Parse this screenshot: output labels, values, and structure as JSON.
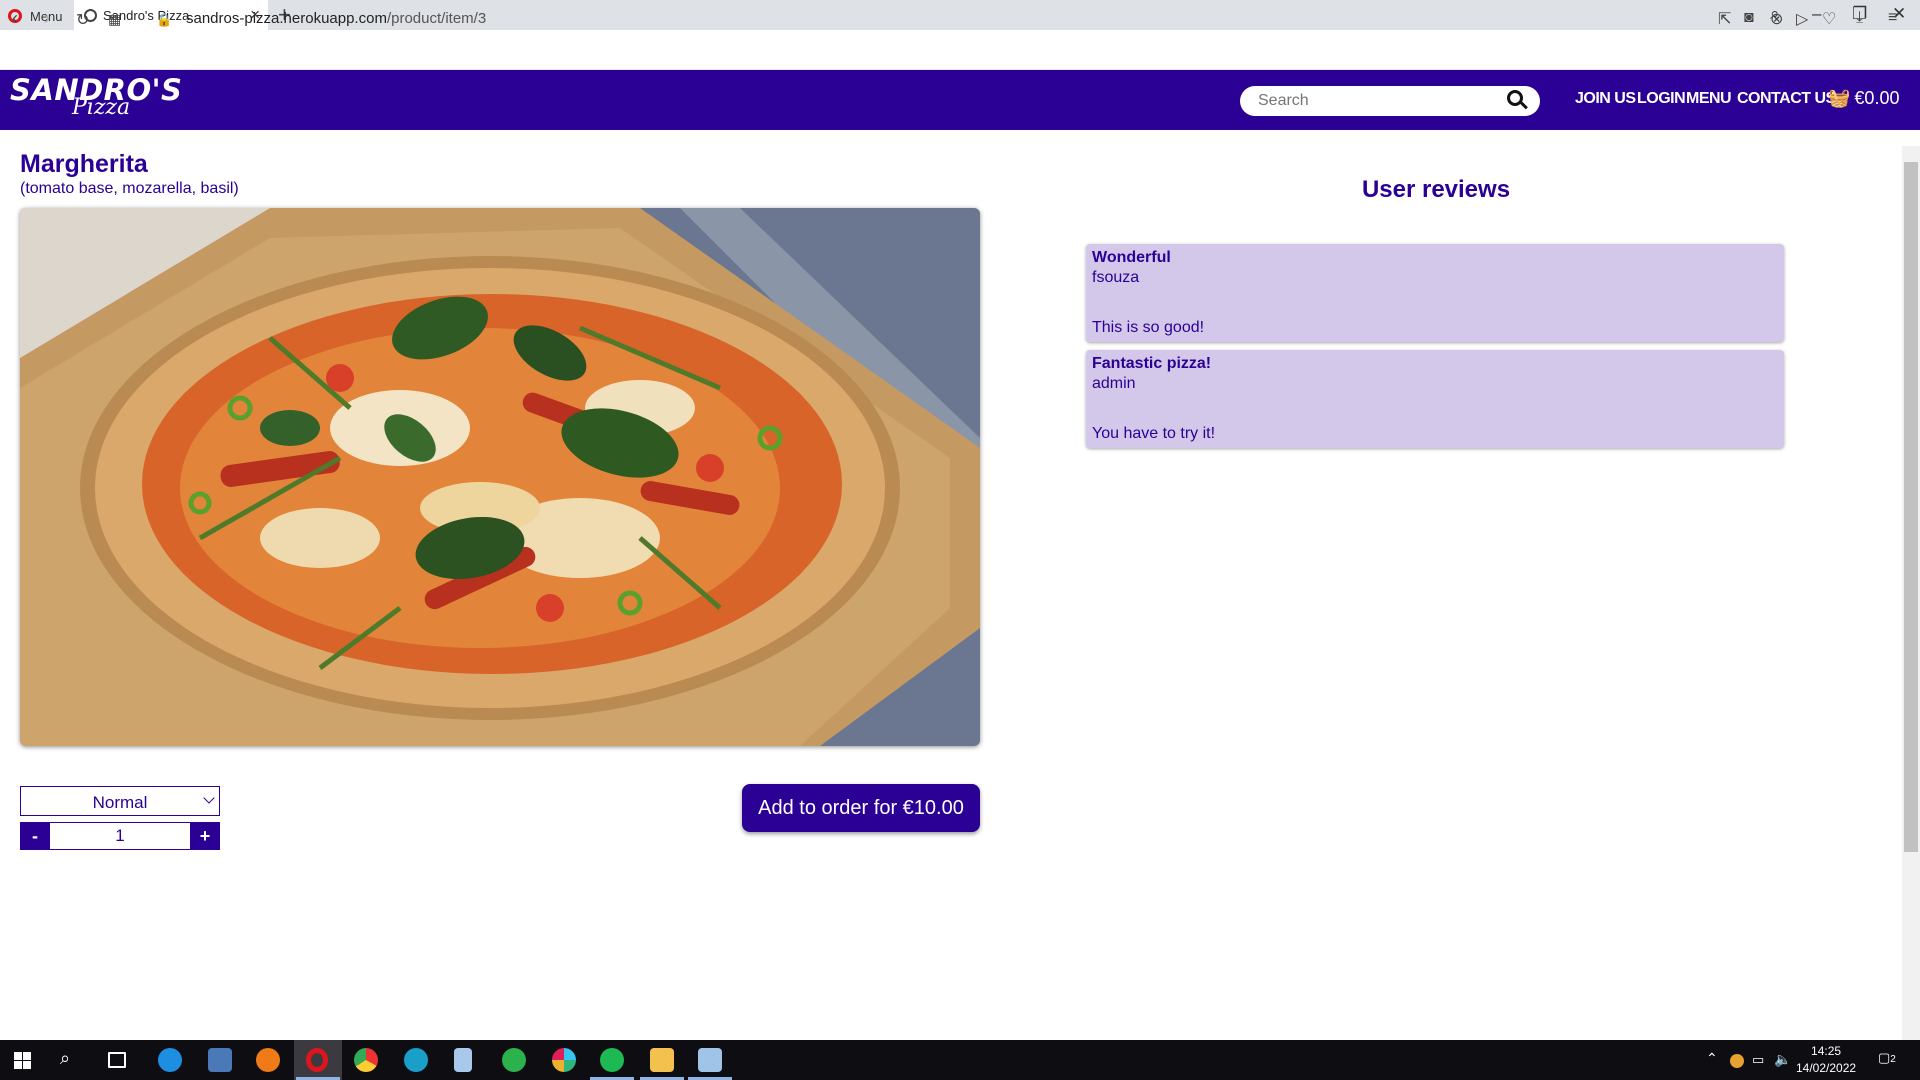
{
  "browser": {
    "menu_label": "Menu",
    "tab_title": "Sandro's Pizza",
    "url_host": "sandros-pizza.herokuapp.com",
    "url_path": "/product/item/3"
  },
  "header": {
    "logo_line1": "SANDRO'S",
    "logo_line2": "Pizza",
    "search_placeholder": "Search",
    "nav": [
      "JOIN US",
      "LOGIN",
      "MENU",
      "CONTACT US"
    ],
    "cart_total": "€0.00"
  },
  "product": {
    "name": "Margherita",
    "description": "(tomato base, mozarella, basil)",
    "size_selected": "Normal",
    "quantity": "1",
    "minus_label": "-",
    "plus_label": "+",
    "add_button": "Add to order for €10.00"
  },
  "reviews": {
    "title": "User reviews",
    "items": [
      {
        "title": "Wonderful",
        "user": "fsouza",
        "body": "This is so good!"
      },
      {
        "title": "Fantastic pizza!",
        "user": "admin",
        "body": "You have to try it!"
      }
    ]
  },
  "taskbar": {
    "time": "14:25",
    "date": "14/02/2022",
    "notifications": "2"
  },
  "colors": {
    "brand": "#2b0094",
    "review_bg": "#d4c8ea"
  }
}
